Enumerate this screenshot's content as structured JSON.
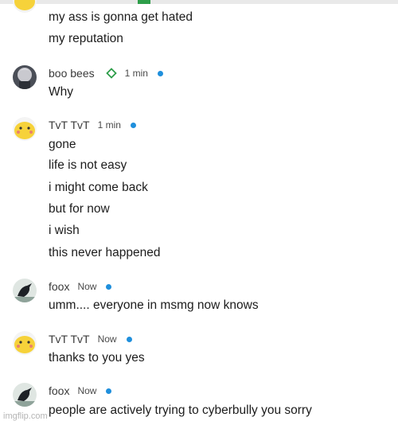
{
  "colors": {
    "online_dot": "#1f8fdc",
    "badge_green": "#2e9e4a",
    "text": "#1c1c1c"
  },
  "messages": [
    {
      "lines": [
        "my ass is gonna get hated",
        "my reputation"
      ]
    },
    {
      "name": "boo bees",
      "avatar": "anime-character-avatar",
      "badge": "diamond-icon",
      "time": "1 min",
      "lines": [
        "Why"
      ]
    },
    {
      "name": "TvT TvT",
      "avatar": "yellow-blob-avatar",
      "time": "1 min",
      "lines": [
        "gone",
        "life is not easy",
        "i might come back",
        "but for now",
        "i wish",
        "this never happened"
      ]
    },
    {
      "name": "foox",
      "avatar": "crow-avatar",
      "time": "Now",
      "lines": [
        "umm.... everyone in msmg now knows"
      ]
    },
    {
      "name": "TvT TvT",
      "avatar": "yellow-blob-avatar",
      "time": "Now",
      "lines": [
        "thanks to you yes"
      ]
    },
    {
      "name": "foox",
      "avatar": "crow-avatar",
      "time": "Now",
      "lines": [
        "people are actively trying to cyberbully you sorry"
      ]
    }
  ],
  "watermark": "imgflip.com"
}
